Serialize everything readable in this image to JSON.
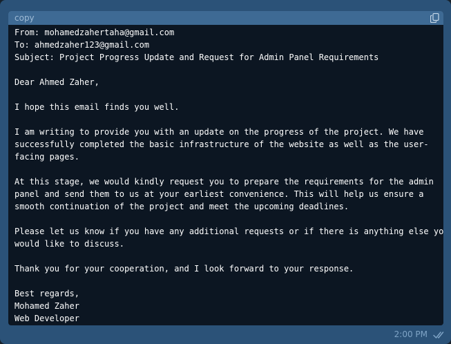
{
  "message": {
    "code_block": {
      "language_label": "copy",
      "lines": [
        "From: mohamedzahertaha@gmail.com",
        "To: ahmedzaher123@gmail.com",
        "Subject: Project Progress Update and Request for Admin Panel Requirements",
        "",
        "Dear Ahmed Zaher,",
        "",
        "I hope this email finds you well.",
        "",
        "I am writing to provide you with an update on the progress of the project. We have",
        "successfully completed the basic infrastructure of the website as well as the user-",
        "facing pages.",
        "",
        "At this stage, we would kindly request you to prepare the requirements for the admin",
        "panel and send them to us at your earliest convenience. This will help us ensure a",
        "smooth continuation of the project and meet the upcoming deadlines.",
        "",
        "Please let us know if you have any additional requests or if there is anything else you",
        "would like to discuss.",
        "",
        "Thank you for your cooperation, and I look forward to your response.",
        "",
        "Best regards,",
        "Mohamed Zaher",
        "Web Developer"
      ]
    },
    "time": "2:00 PM",
    "status_icon": "double-check-icon",
    "colors": {
      "bubble": "#2b5278",
      "code_background": "#0c1622",
      "code_header": "#3e6a94",
      "text": "#ffffff",
      "meta": "#7fa4c6"
    }
  }
}
